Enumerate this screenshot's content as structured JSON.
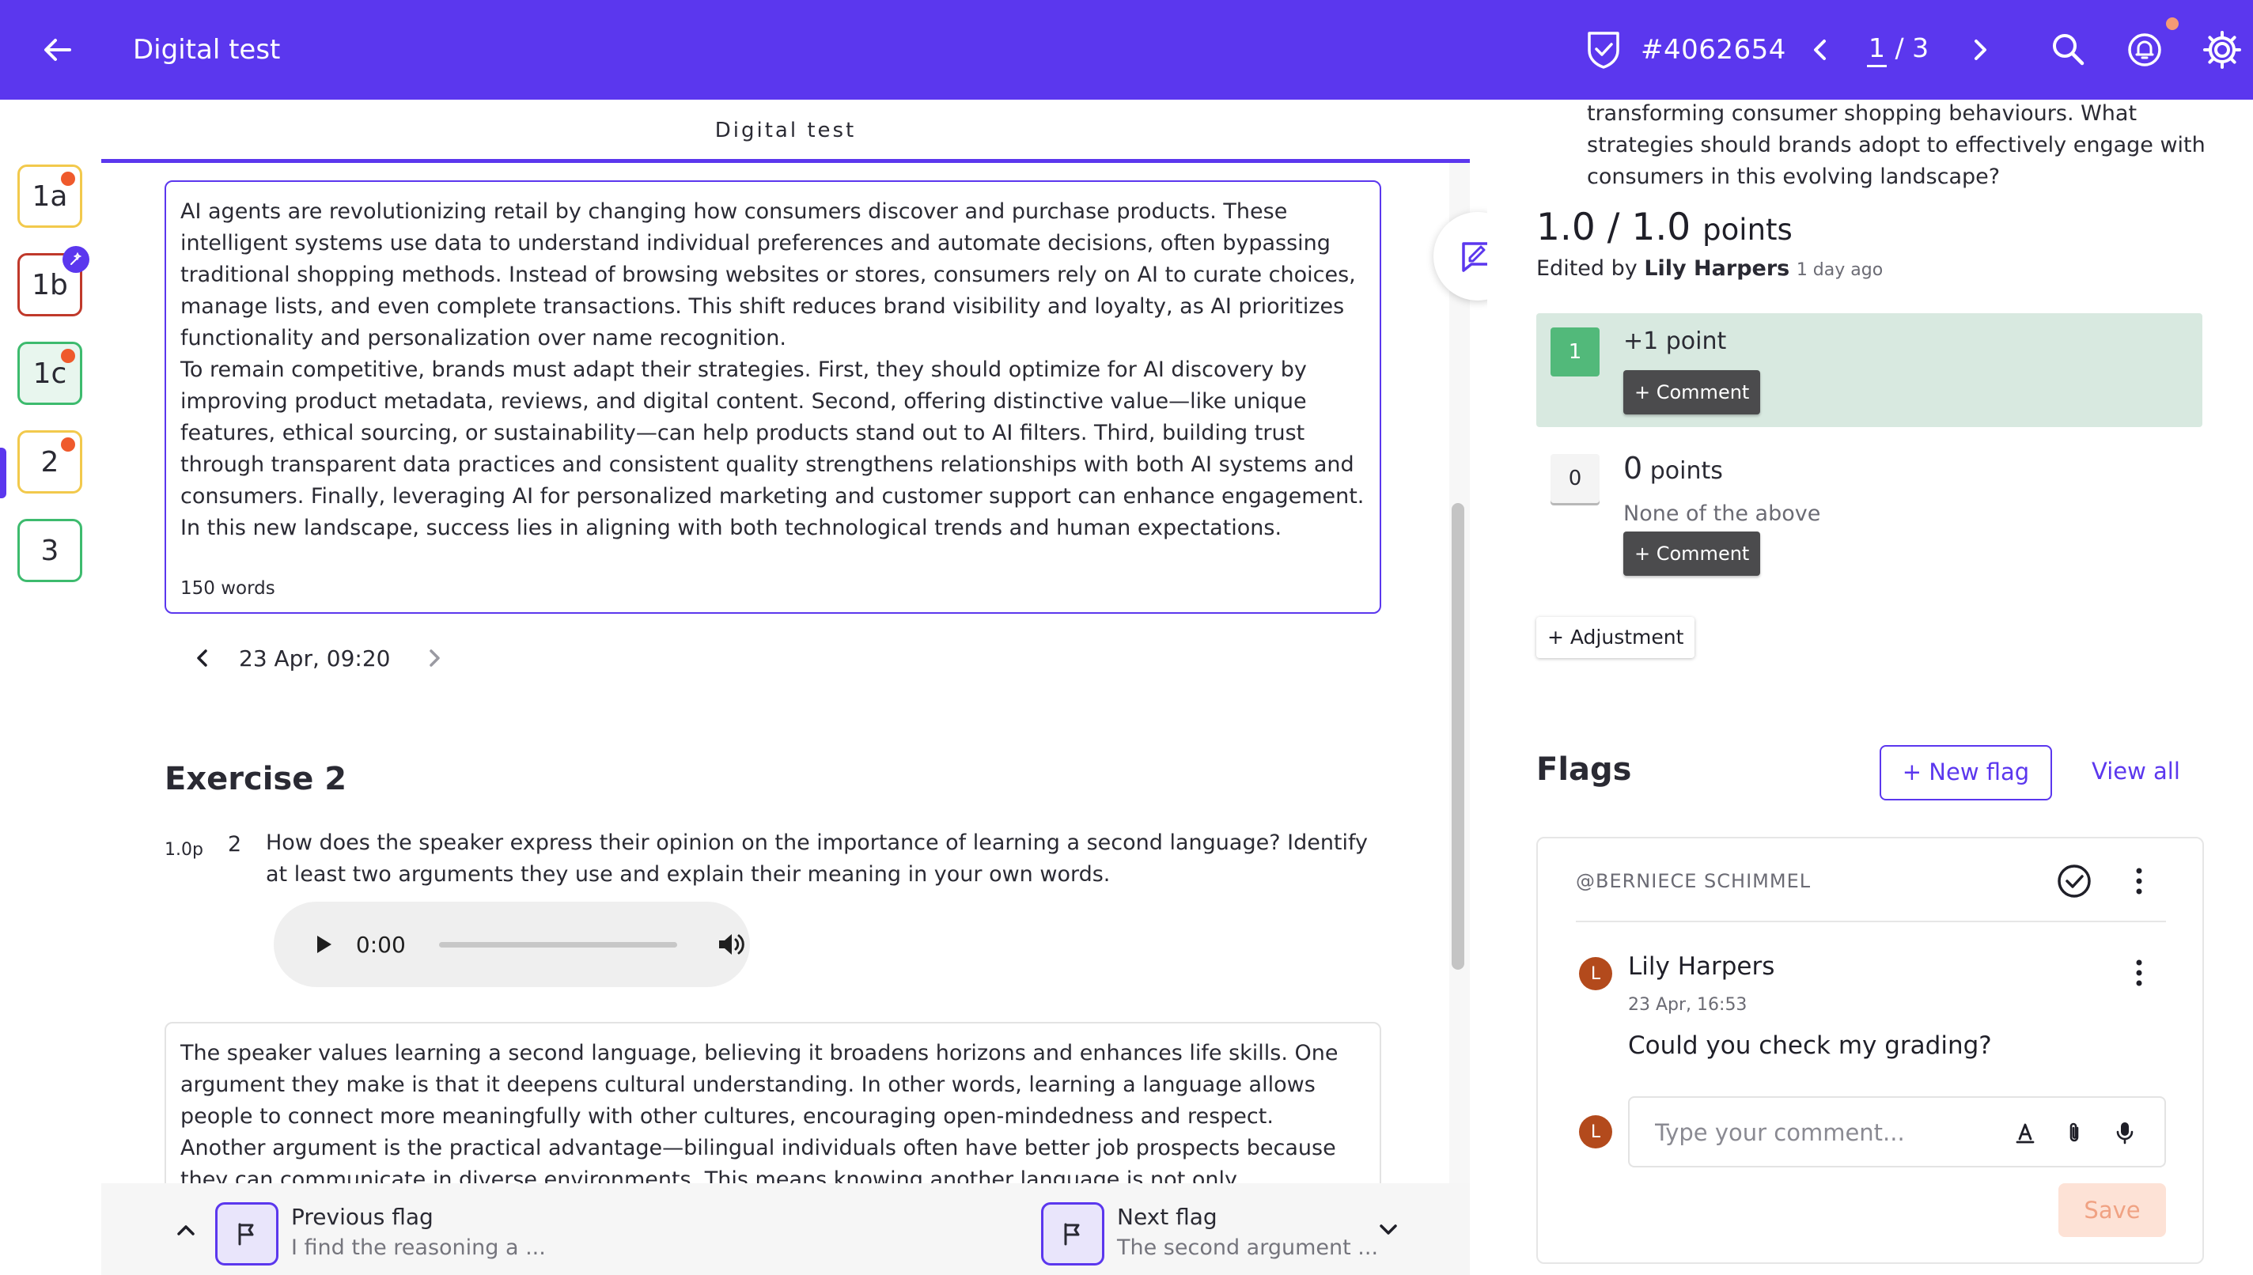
{
  "header": {
    "title": "Digital test",
    "submission_id": "#4062654",
    "page_current": "1",
    "page_sep": " / ",
    "page_total": "3"
  },
  "questions": [
    {
      "label": "1a",
      "color": "#f2c94c",
      "dot": true,
      "edited": false,
      "active": false
    },
    {
      "label": "1b",
      "color": "#c0392b",
      "dot": false,
      "edited": true,
      "active": false
    },
    {
      "label": "1c",
      "color": "#3dbb6e",
      "dot": true,
      "edited": false,
      "active": true
    },
    {
      "label": "2",
      "color": "#f2c94c",
      "dot": true,
      "edited": false,
      "active": false
    },
    {
      "label": "3",
      "color": "#3dbb6e",
      "dot": false,
      "edited": false,
      "active": false
    }
  ],
  "center": {
    "tab_title": "Digital test",
    "answer_paragraphs": [
      "AI agents are revolutionizing retail by changing how consumers discover and purchase products. These intelligent systems use data to understand individual preferences and automate decisions, often bypassing traditional shopping methods. Instead of browsing websites or stores, consumers rely on AI to curate choices, manage lists, and even complete transactions. This shift reduces brand visibility and loyalty, as AI prioritizes functionality and personalization over name recognition.",
      "To remain competitive, brands must adapt their strategies. First, they should optimize for AI discovery by improving product metadata, reviews, and digital content. Second, offering distinctive value—like unique features, ethical sourcing, or sustainability—can help products stand out to AI filters. Third, building trust through transparent data practices and consistent quality strengthens relationships with both AI systems and consumers. Finally, leveraging AI for personalized marketing and customer support can enhance engagement. In this new landscape, success lies in aligning with both technological trends and human expectations."
    ],
    "word_count": "150 words",
    "history_date": "23 Apr, 09:20",
    "exercise_title": "Exercise 2",
    "q2_points": "1.0p",
    "q2_number": "2",
    "q2_text": "How does the speaker express their opinion on the importance of learning a second language? Identify at least two arguments they use and explain their meaning in your own words.",
    "audio_time": "0:00",
    "audio_progress": 0,
    "answer2_text": "The speaker values learning a second language, believing it broadens horizons and enhances life skills. One argument they make is that it deepens cultural understanding. In other words, learning a language allows people to connect more meaningfully with other cultures, encouraging open-mindedness and respect. Another argument is the practical advantage—bilingual individuals often have better job prospects because they can communicate in diverse environments. This means knowing another language is not only intellectually enriching but also economically"
  },
  "flagbar": {
    "prev_title": "Previous flag",
    "prev_snippet": "I find the reasoning a ...",
    "next_title": "Next flag",
    "next_snippet": "The second argument ..."
  },
  "grading": {
    "question_prompt": "transforming consumer shopping behaviours. What strategies should brands adopt to effectively engage with consumers in this evolving landscape?",
    "score": "1.0 / 1.0",
    "score_unit": "points",
    "edited_prefix": "Edited by",
    "edited_by": "Lily Harpers",
    "edited_ago": "1 day ago",
    "criteria": [
      {
        "badge": "1",
        "title": "+1 point",
        "subtitle": "",
        "comment_label": "+ Comment",
        "selected": true
      },
      {
        "badge": "0",
        "title_num": "0",
        "title_unit": "points",
        "subtitle": "None of the above",
        "comment_label": "+ Comment",
        "selected": false
      }
    ],
    "adjustment_label": "+ Adjustment"
  },
  "flags": {
    "title": "Flags",
    "new_flag_label": "+ New flag",
    "view_all_label": "View all",
    "card": {
      "mention": "@BERNIECE SCHIMMEL",
      "author_initial": "L",
      "author": "Lily Harpers",
      "time": "23 Apr, 16:53",
      "message": "Could you check my grading?",
      "input_placeholder": "Type your comment...",
      "save_label": "Save"
    }
  },
  "colors": {
    "brand": "#5b37ee",
    "selected_criterion_bg": "#d8e9e0",
    "selected_badge": "#52b97a",
    "avatar": "#b34a1c",
    "notification_dot": "#ef5a2c"
  }
}
